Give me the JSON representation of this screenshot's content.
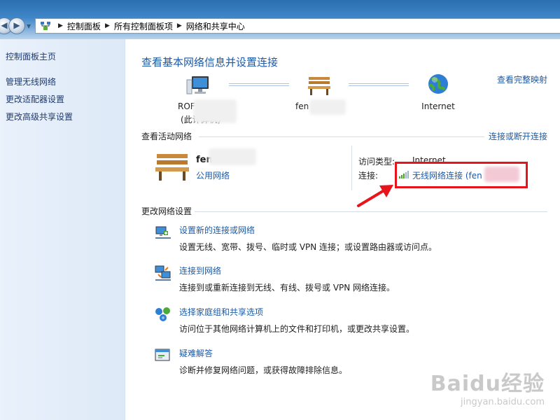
{
  "breadcrumb": [
    "控制面板",
    "所有控制面板项",
    "网络和共享中心"
  ],
  "sidebar": {
    "home": "控制面板主页",
    "items": [
      "管理无线网络",
      "更改适配器设置",
      "更改高级共享设置"
    ]
  },
  "main": {
    "title": "查看基本网络信息并设置连接",
    "map_link": "查看完整映射",
    "nodes": {
      "computer_name": "ROF",
      "computer_sub": "(此计算机)",
      "network_name": "fen",
      "internet": "Internet"
    },
    "active": {
      "header": "查看活动网络",
      "connect_link": "连接或断开连接",
      "network_name": "fen",
      "network_type": "公用网络",
      "access_label": "访问类型:",
      "access_value": "Internet",
      "conn_label": "连接:",
      "conn_value": "无线网络连接 (fen"
    },
    "change": {
      "header": "更改网络设置",
      "tasks": [
        {
          "title": "设置新的连接或网络",
          "desc": "设置无线、宽带、拨号、临时或 VPN 连接；或设置路由器或访问点。"
        },
        {
          "title": "连接到网络",
          "desc": "连接到或重新连接到无线、有线、拨号或 VPN 网络连接。"
        },
        {
          "title": "选择家庭组和共享选项",
          "desc": "访问位于其他网络计算机上的文件和打印机，或更改共享设置。"
        },
        {
          "title": "疑难解答",
          "desc": "诊断并修复网络问题，或获得故障排除信息。"
        }
      ]
    }
  },
  "watermark": {
    "brand": "Baidu经验",
    "url": "jingyan.baidu.com"
  }
}
